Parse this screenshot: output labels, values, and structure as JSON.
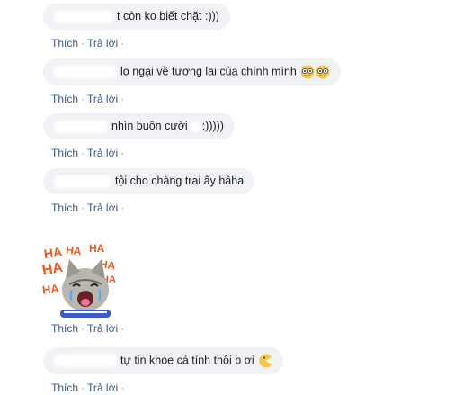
{
  "comments": [
    {
      "text": "t còn ko biết chặt :)))",
      "like": "Thích",
      "reply": "Trả lời",
      "sep": "·"
    },
    {
      "text": "lo ngại về tương lai của chính mình",
      "emoji": [
        "nerd-face-icon",
        "nerd-face-icon"
      ],
      "like": "Thích",
      "reply": "Trả lời",
      "sep": "·"
    },
    {
      "text_before": "nhìn buồn cười",
      "text_after": ":)))))",
      "like": "Thích",
      "reply": "Trả lời",
      "sep": "·"
    },
    {
      "text": "tội cho chàng trai ấy hâha",
      "like": "Thích",
      "reply": "Trả lời",
      "sep": "·"
    },
    {
      "sticker": {
        "label": "HA HA HA HA HA HA",
        "icon": "laughing-cat-sticker"
      },
      "like": "Thích",
      "reply": "Trả lời",
      "sep": "·"
    },
    {
      "text": "tự tin khoe cá tính thôi b ơi",
      "emoji": [
        "pacman-icon"
      ],
      "like": "Thích",
      "reply": "Trả lời",
      "sep": "·"
    }
  ],
  "colors": {
    "bubble": "#f0f2f5",
    "link": "#385898",
    "text": "#1c1e21"
  }
}
